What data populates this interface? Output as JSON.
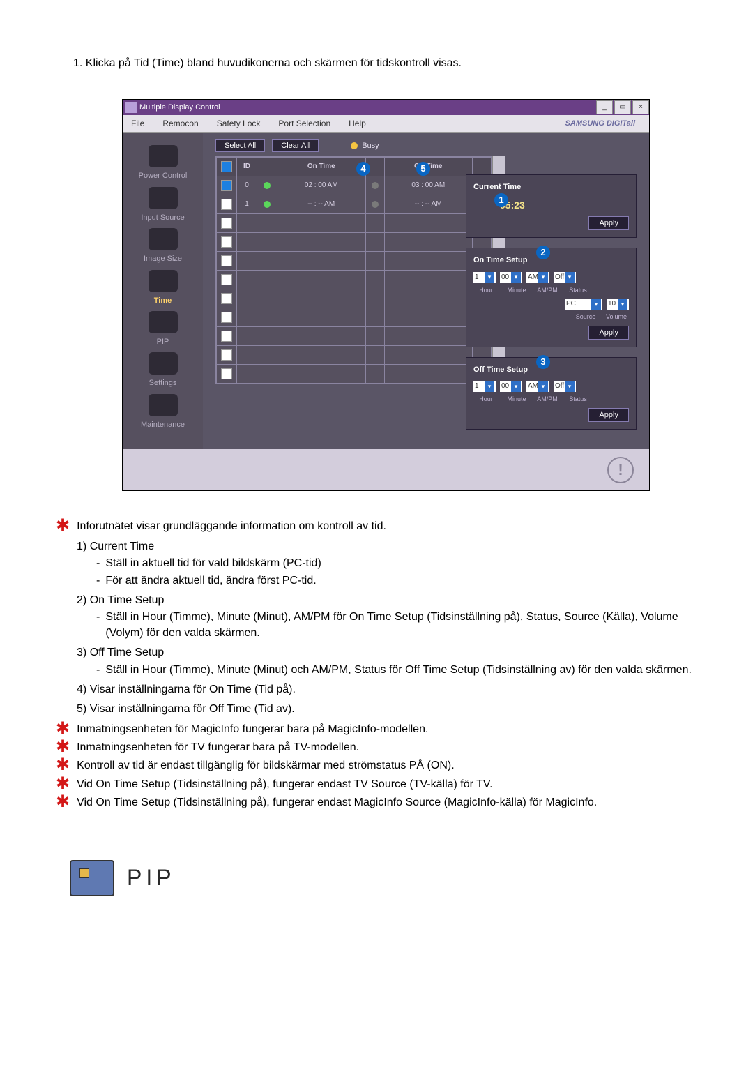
{
  "intro_step": "1.  Klicka på Tid (Time) bland huvudikonerna och skärmen för tidskontroll visas.",
  "app": {
    "title": "Multiple Display Control",
    "menu": [
      "File",
      "Remocon",
      "Safety Lock",
      "Port Selection",
      "Help"
    ],
    "brand": "SAMSUNG DIGITall"
  },
  "sidebar": [
    "Power Control",
    "Input Source",
    "Image Size",
    "Time",
    "PIP",
    "Settings",
    "Maintenance"
  ],
  "sidebar_active": "Time",
  "buttons": {
    "select_all": "Select All",
    "clear_all": "Clear All",
    "busy": "Busy"
  },
  "table": {
    "headers": {
      "chk": "☑",
      "id": "ID",
      "pw": "",
      "on": "On Time",
      "off": "Off Time",
      "led2": ""
    },
    "rows": [
      {
        "chk": true,
        "id": "0",
        "green": true,
        "on": "02 : 00 AM",
        "led1": "gr",
        "off": "03 : 00 AM",
        "led2": "gr"
      },
      {
        "chk": false,
        "id": "1",
        "green": true,
        "on": "-- : -- AM",
        "led1": "gr",
        "off": "-- : -- AM",
        "led2": "gr"
      }
    ]
  },
  "callouts": {
    "c1": "1",
    "c2": "2",
    "c3": "3",
    "c4": "4",
    "c5": "5"
  },
  "panel": {
    "current_title": "Current Time",
    "time": "05:23",
    "apply": "Apply",
    "on_title": "On Time Setup",
    "off_title": "Off Time Setup",
    "hour": "1",
    "minute": "00",
    "ampm": "AM",
    "status": "Off",
    "source": "PC",
    "volume": "10",
    "lbl_hour": "Hour",
    "lbl_minute": "Minute",
    "lbl_ampm": "AM/PM",
    "lbl_status": "Status",
    "lbl_source": "Source",
    "lbl_volume": "Volume"
  },
  "notes": {
    "n1": "Inforutnätet visar grundläggande information om kontroll av tid.",
    "list": [
      {
        "num": "1)",
        "label": "Current Time",
        "subs": [
          "Ställ in aktuell tid för vald bildskärm (PC-tid)",
          "För att ändra aktuell tid, ändra först PC-tid."
        ]
      },
      {
        "num": "2)",
        "label": "On Time Setup",
        "subs": [
          "Ställ in Hour (Timme), Minute (Minut), AM/PM för On Time Setup (Tidsinställning på), Status, Source (Källa), Volume (Volym) för den valda skärmen."
        ]
      },
      {
        "num": "3)",
        "label": "Off Time Setup",
        "subs": [
          "Ställ in Hour (Timme), Minute (Minut) och AM/PM, Status för Off Time Setup (Tidsinställning av) för den valda skärmen."
        ]
      },
      {
        "num": "4)",
        "label": "Visar inställningarna för On Time (Tid på).",
        "subs": []
      },
      {
        "num": "5)",
        "label": "Visar inställningarna för Off Time (Tid av).",
        "subs": []
      }
    ],
    "stars": [
      "Inmatningsenheten för MagicInfo fungerar bara på MagicInfo-modellen.",
      "Inmatningsenheten för TV fungerar bara på TV-modellen.",
      "Kontroll av tid är endast tillgänglig för bildskärmar med strömstatus PÅ (ON).",
      "Vid On Time Setup (Tidsinställning på), fungerar endast TV Source (TV-källa) för TV.",
      "Vid On Time Setup (Tidsinställning på), fungerar endast MagicInfo Source (MagicInfo-källa) för MagicInfo."
    ]
  },
  "pip_title": "PIP"
}
